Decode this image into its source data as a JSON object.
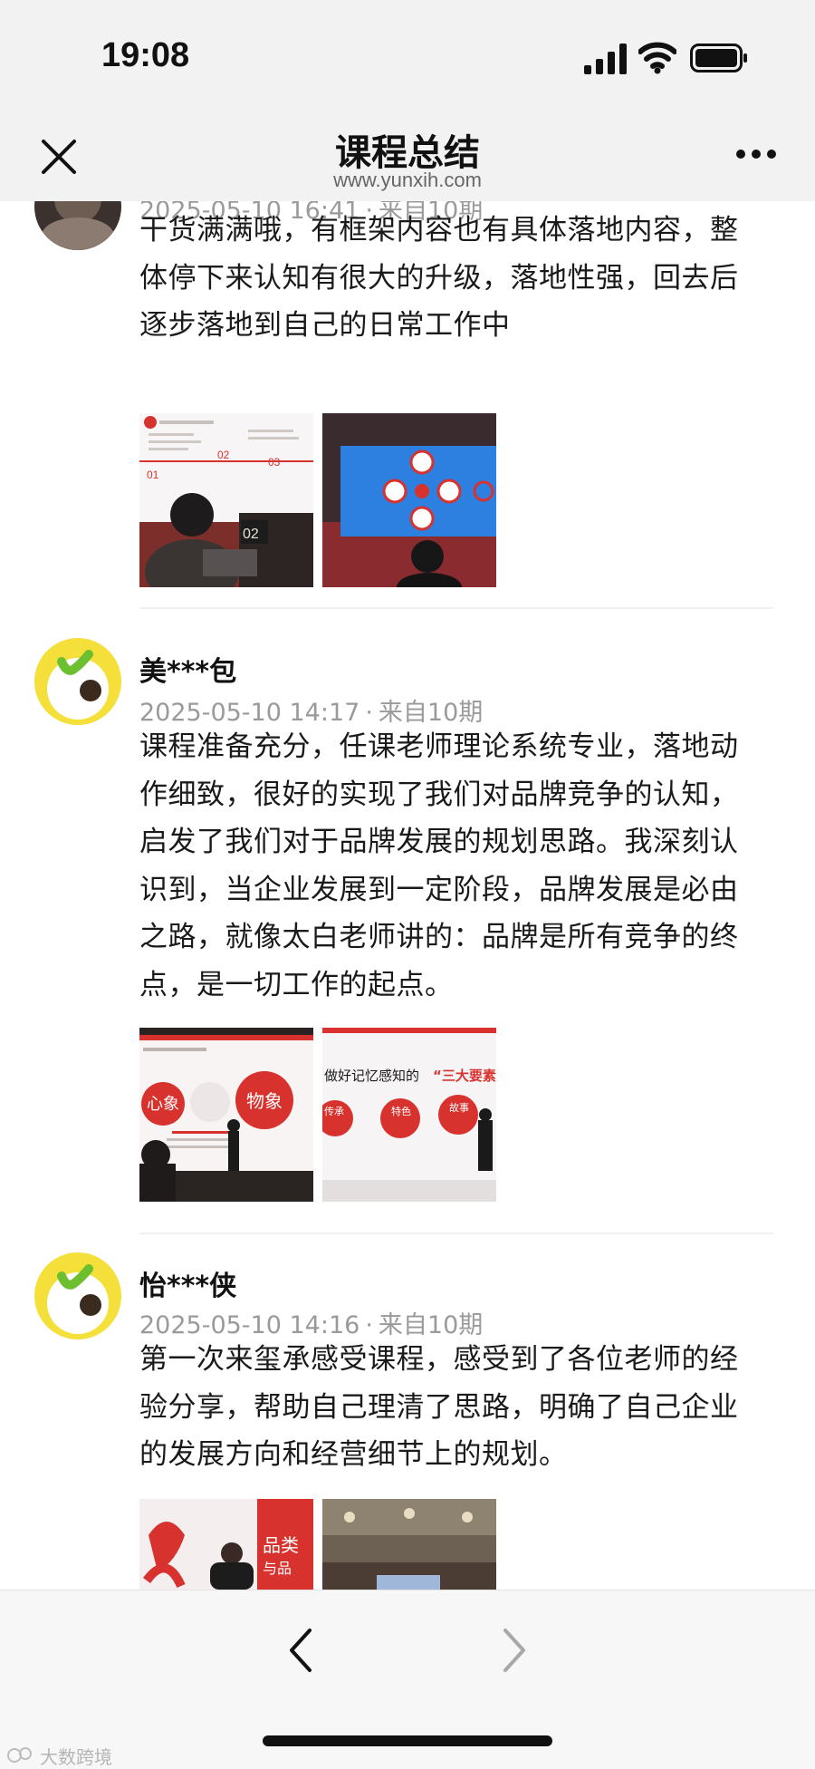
{
  "status_bar": {
    "time": "19:08"
  },
  "header": {
    "title": "课程总结",
    "subtitle": "www.yunxih.com"
  },
  "posts": [
    {
      "username": "",
      "date": "2025-05-10 16:41",
      "source": "来自10期",
      "content": "干货满满哦，有框架内容也有具体落地内容，整体停下来认知有很大的升级，落地性强，回去后逐步落地到自己的日常工作中",
      "photos": [
        {
          "texts": [
            "01",
            "02",
            "03"
          ]
        },
        {
          "texts": []
        }
      ]
    },
    {
      "username": "美***包",
      "date": "2025-05-10 14:17",
      "source": "来自10期",
      "content": "课程准备充分，任课老师理论系统专业，落地动作细致，很好的实现了我们对品牌竞争的认知，启发了我们对于品牌发展的规划思路。我深刻认识到，当企业发展到一定阶段，品牌发展是必由之路，就像太白老师讲的：品牌是所有竞争的终点，是一切工作的起点。",
      "photos": [
        {
          "texts": [
            "心象",
            "物象"
          ]
        },
        {
          "texts": [
            "做好记忆感知的",
            "“三大要素",
            "传承",
            "特色",
            "故事"
          ]
        }
      ]
    },
    {
      "username": "怡***侠",
      "date": "2025-05-10 14:16",
      "source": "来自10期",
      "content": "第一次来玺承感受课程，感受到了各位老师的经验分享，帮助自己理清了思路，明确了自己企业的发展方向和经营细节上的规划。",
      "photos": [
        {
          "texts": [
            "品类",
            "与品"
          ]
        },
        {
          "texts": []
        }
      ]
    }
  ],
  "watermark": "大数跨境"
}
